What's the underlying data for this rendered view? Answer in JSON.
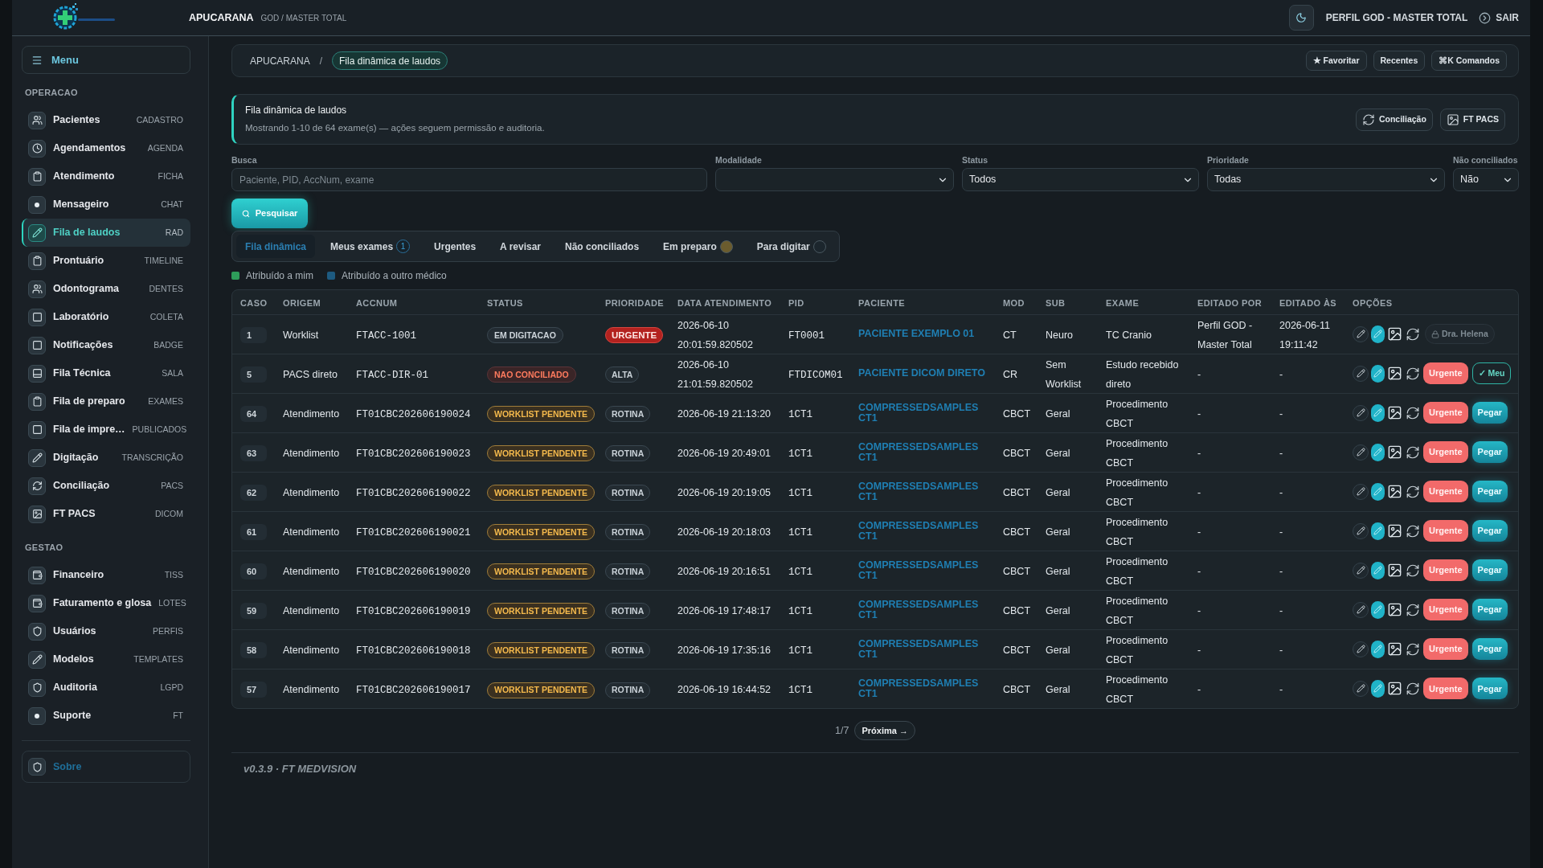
{
  "header": {
    "location": "APUCARANA",
    "profile_tag": "GOD / MASTER TOTAL",
    "user": "PERFIL GOD - MASTER TOTAL",
    "logout": "SAIR"
  },
  "sidebar": {
    "menu_label": "Menu",
    "sections": [
      {
        "title": "OPERACAO",
        "items": [
          {
            "label": "Pacientes",
            "tag": "CADASTRO",
            "selected": false
          },
          {
            "label": "Agendamentos",
            "tag": "AGENDA",
            "selected": false
          },
          {
            "label": "Atendimento",
            "tag": "FICHA",
            "selected": false
          },
          {
            "label": "Mensageiro",
            "tag": "CHAT",
            "selected": false
          },
          {
            "label": "Fila de laudos",
            "tag": "RAD",
            "selected": true
          },
          {
            "label": "Prontuário",
            "tag": "TIMELINE",
            "selected": false
          },
          {
            "label": "Odontograma",
            "tag": "DENTES",
            "selected": false
          },
          {
            "label": "Laboratório",
            "tag": "COLETA",
            "selected": false
          },
          {
            "label": "Notificações",
            "tag": "BADGE",
            "selected": false
          },
          {
            "label": "Fila Técnica",
            "tag": "SALA",
            "selected": false
          },
          {
            "label": "Fila de preparo",
            "tag": "EXAMES",
            "selected": false
          },
          {
            "label": "Fila de impre…",
            "tag": "PUBLICADOS",
            "selected": false
          },
          {
            "label": "Digitação",
            "tag": "TRANSCRIÇÃO",
            "selected": false
          },
          {
            "label": "Conciliação",
            "tag": "PACS",
            "selected": false
          },
          {
            "label": "FT PACS",
            "tag": "DICOM",
            "selected": false
          }
        ]
      },
      {
        "title": "GESTAO",
        "items": [
          {
            "label": "Financeiro",
            "tag": "TISS",
            "selected": false
          },
          {
            "label": "Faturamento e glosa",
            "tag": "LOTES",
            "selected": false
          },
          {
            "label": "Usuários",
            "tag": "PERFIS",
            "selected": false
          },
          {
            "label": "Modelos",
            "tag": "TEMPLATES",
            "selected": false
          },
          {
            "label": "Auditoria",
            "tag": "LGPD",
            "selected": false
          },
          {
            "label": "Suporte",
            "tag": "FT",
            "selected": false
          }
        ]
      }
    ],
    "about": "Sobre"
  },
  "breadcrumb": {
    "items": [
      "APUCARANA",
      "Fila dinâmica de laudos"
    ],
    "separator": "/",
    "actions": [
      "★ Favoritar",
      "Recentes",
      "⌘K Comandos"
    ]
  },
  "notice": {
    "title": "Fila dinâmica de laudos",
    "text": "Mostrando 1-10 de 64 exame(s) — ações seguem permissão e auditoria.",
    "actions": [
      "Conciliação",
      "FT PACS"
    ]
  },
  "filters": [
    {
      "label": "Busca",
      "kind": "text",
      "placeholder": "Paciente, PID, AccNum, exame"
    },
    {
      "label": "Modalidade",
      "kind": "select"
    },
    {
      "label": "Status",
      "kind": "select",
      "value": "Todos"
    },
    {
      "label": "Prioridade",
      "kind": "select",
      "value": "Todas"
    },
    {
      "label": "Não conciliados",
      "kind": "select",
      "value": "Não"
    }
  ],
  "search_button": "Pesquisar",
  "tabs": [
    {
      "label": "Fila dinâmica",
      "selected": true
    },
    {
      "label": "Meus exames",
      "selected": false,
      "count": "1"
    },
    {
      "label": "Urgentes",
      "selected": false
    },
    {
      "label": "A revisar",
      "selected": false
    },
    {
      "label": "Não conciliados",
      "selected": false
    },
    {
      "label": "Em preparo",
      "selected": false,
      "color": "#6b5c2e"
    },
    {
      "label": "Para digitar",
      "selected": false,
      "color": "#1c262d"
    }
  ],
  "legend": [
    {
      "label": "Atribuído a mim",
      "color": "#2e9c5a"
    },
    {
      "label": "Atribuído a outro médico",
      "color": "#1d5a80"
    }
  ],
  "table": {
    "columns": [
      "CASO",
      "ORIGEM",
      "ACCNUM",
      "STATUS",
      "PRIORIDADE",
      "DATA ATENDIMENTO",
      "PID",
      "PACIENTE",
      "MOD",
      "SUB",
      "EXAME",
      "EDITADO POR",
      "EDITADO ÀS",
      "OPÇÕES"
    ],
    "rows": [
      {
        "case": "1",
        "origin": "Worklist",
        "accnum": "FTACC-1001",
        "status": {
          "text": "EM DIGITACAO",
          "kind": "neutral"
        },
        "priority": {
          "text": "URGENTE",
          "kind": "urgent"
        },
        "date": "2026-06-10 20:01:59.820502",
        "pid": "FT0001",
        "patient": "PACIENTE EXEMPLO 01",
        "modality": "CT",
        "sub": "Neuro",
        "exam": "TC Cranio",
        "edited_by": "Perfil GOD - Master Total",
        "edited_at": "2026-06-11 19:11:42",
        "actions": [
          {
            "kind": "locked",
            "label": "Dra. Helena"
          }
        ]
      },
      {
        "case": "5",
        "origin": "PACS direto",
        "accnum": "FTACC-DIR-01",
        "status": {
          "text": "NAO CONCILIADO",
          "kind": "danger"
        },
        "priority": {
          "text": "ALTA",
          "kind": "normal"
        },
        "date": "2026-06-10 21:01:59.820502",
        "pid": "FTDICOM01",
        "patient": "PACIENTE DICOM DIRETO",
        "modality": "CR",
        "sub": "Sem Worklist",
        "exam": "Estudo recebido direto",
        "edited_by": "-",
        "edited_at": "-",
        "actions": [
          {
            "kind": "urgent",
            "label": "Urgente"
          },
          {
            "kind": "mine",
            "label": "✓ Meu"
          }
        ]
      },
      {
        "case": "64",
        "origin": "Atendimento",
        "accnum": "FT01CBC202606190024",
        "status": {
          "text": "WORKLIST PENDENTE",
          "kind": "warning"
        },
        "priority": {
          "text": "ROTINA",
          "kind": "normal"
        },
        "date": "2026-06-19 21:13:20",
        "pid": "1CT1",
        "patient": "COMPRESSEDSAMPLES CT1",
        "modality": "CBCT",
        "sub": "Geral",
        "exam": "Procedimento CBCT",
        "edited_by": "-",
        "edited_at": "-",
        "actions": [
          {
            "kind": "urgent",
            "label": "Urgente"
          },
          {
            "kind": "take",
            "label": "Pegar"
          }
        ]
      },
      {
        "case": "63",
        "origin": "Atendimento",
        "accnum": "FT01CBC202606190023",
        "status": {
          "text": "WORKLIST PENDENTE",
          "kind": "warning"
        },
        "priority": {
          "text": "ROTINA",
          "kind": "normal"
        },
        "date": "2026-06-19 20:49:01",
        "pid": "1CT1",
        "patient": "COMPRESSEDSAMPLES CT1",
        "modality": "CBCT",
        "sub": "Geral",
        "exam": "Procedimento CBCT",
        "edited_by": "-",
        "edited_at": "-",
        "actions": [
          {
            "kind": "urgent",
            "label": "Urgente"
          },
          {
            "kind": "take",
            "label": "Pegar"
          }
        ]
      },
      {
        "case": "62",
        "origin": "Atendimento",
        "accnum": "FT01CBC202606190022",
        "status": {
          "text": "WORKLIST PENDENTE",
          "kind": "warning"
        },
        "priority": {
          "text": "ROTINA",
          "kind": "normal"
        },
        "date": "2026-06-19 20:19:05",
        "pid": "1CT1",
        "patient": "COMPRESSEDSAMPLES CT1",
        "modality": "CBCT",
        "sub": "Geral",
        "exam": "Procedimento CBCT",
        "edited_by": "-",
        "edited_at": "-",
        "actions": [
          {
            "kind": "urgent",
            "label": "Urgente"
          },
          {
            "kind": "take",
            "label": "Pegar"
          }
        ]
      },
      {
        "case": "61",
        "origin": "Atendimento",
        "accnum": "FT01CBC202606190021",
        "status": {
          "text": "WORKLIST PENDENTE",
          "kind": "warning"
        },
        "priority": {
          "text": "ROTINA",
          "kind": "normal"
        },
        "date": "2026-06-19 20:18:03",
        "pid": "1CT1",
        "patient": "COMPRESSEDSAMPLES CT1",
        "modality": "CBCT",
        "sub": "Geral",
        "exam": "Procedimento CBCT",
        "edited_by": "-",
        "edited_at": "-",
        "actions": [
          {
            "kind": "urgent",
            "label": "Urgente"
          },
          {
            "kind": "take",
            "label": "Pegar"
          }
        ]
      },
      {
        "case": "60",
        "origin": "Atendimento",
        "accnum": "FT01CBC202606190020",
        "status": {
          "text": "WORKLIST PENDENTE",
          "kind": "warning"
        },
        "priority": {
          "text": "ROTINA",
          "kind": "normal"
        },
        "date": "2026-06-19 20:16:51",
        "pid": "1CT1",
        "patient": "COMPRESSEDSAMPLES CT1",
        "modality": "CBCT",
        "sub": "Geral",
        "exam": "Procedimento CBCT",
        "edited_by": "-",
        "edited_at": "-",
        "actions": [
          {
            "kind": "urgent",
            "label": "Urgente"
          },
          {
            "kind": "take",
            "label": "Pegar"
          }
        ]
      },
      {
        "case": "59",
        "origin": "Atendimento",
        "accnum": "FT01CBC202606190019",
        "status": {
          "text": "WORKLIST PENDENTE",
          "kind": "warning"
        },
        "priority": {
          "text": "ROTINA",
          "kind": "normal"
        },
        "date": "2026-06-19 17:48:17",
        "pid": "1CT1",
        "patient": "COMPRESSEDSAMPLES CT1",
        "modality": "CBCT",
        "sub": "Geral",
        "exam": "Procedimento CBCT",
        "edited_by": "-",
        "edited_at": "-",
        "actions": [
          {
            "kind": "urgent",
            "label": "Urgente"
          },
          {
            "kind": "take",
            "label": "Pegar"
          }
        ]
      },
      {
        "case": "58",
        "origin": "Atendimento",
        "accnum": "FT01CBC202606190018",
        "status": {
          "text": "WORKLIST PENDENTE",
          "kind": "warning"
        },
        "priority": {
          "text": "ROTINA",
          "kind": "normal"
        },
        "date": "2026-06-19 17:35:16",
        "pid": "1CT1",
        "patient": "COMPRESSEDSAMPLES CT1",
        "modality": "CBCT",
        "sub": "Geral",
        "exam": "Procedimento CBCT",
        "edited_by": "-",
        "edited_at": "-",
        "actions": [
          {
            "kind": "urgent",
            "label": "Urgente"
          },
          {
            "kind": "take",
            "label": "Pegar"
          }
        ]
      },
      {
        "case": "57",
        "origin": "Atendimento",
        "accnum": "FT01CBC202606190017",
        "status": {
          "text": "WORKLIST PENDENTE",
          "kind": "warning"
        },
        "priority": {
          "text": "ROTINA",
          "kind": "normal"
        },
        "date": "2026-06-19 16:44:52",
        "pid": "1CT1",
        "patient": "COMPRESSEDSAMPLES CT1",
        "modality": "CBCT",
        "sub": "Geral",
        "exam": "Procedimento CBCT",
        "edited_by": "-",
        "edited_at": "-",
        "actions": [
          {
            "kind": "urgent",
            "label": "Urgente"
          },
          {
            "kind": "take",
            "label": "Pegar"
          }
        ]
      }
    ]
  },
  "pagination": {
    "page": "1/7",
    "next": "Próxima →"
  },
  "footer": "v0.3.9 · FT MEDVISION"
}
